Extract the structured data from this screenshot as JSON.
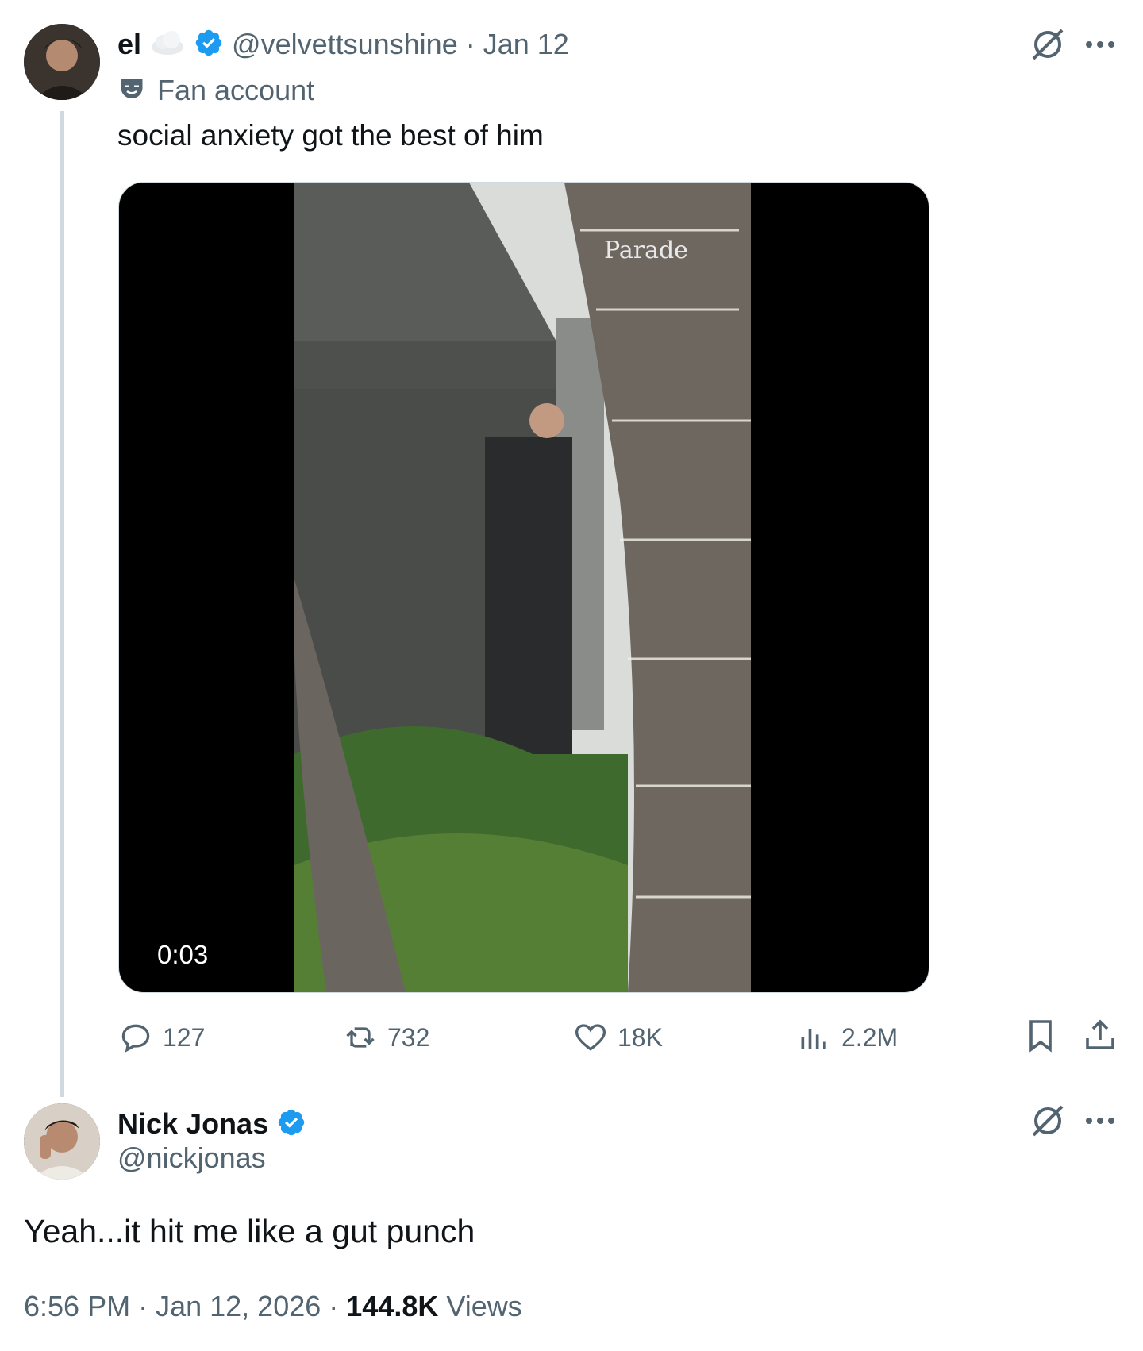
{
  "parent_tweet": {
    "display_name": "el",
    "name_emoji": "cloud",
    "handle": "@velvettsunshine",
    "separator": "·",
    "date": "Jan 12",
    "label": "Fan account",
    "label_icon": "theater-mask-icon",
    "text": "social anxiety got the best of him",
    "media": {
      "watermark": "Parade",
      "duration": "0:03"
    },
    "actions": {
      "replies": "127",
      "reposts": "732",
      "likes": "18K",
      "views": "2.2M"
    }
  },
  "reply_tweet": {
    "display_name": "Nick Jonas",
    "handle": "@nickjonas",
    "text": "Yeah...it hit me like a gut punch",
    "time": "6:56 PM",
    "separator": "·",
    "date": "Jan 12, 2026",
    "separator2": "·",
    "views_count": "144.8K",
    "views_label": "Views"
  },
  "colors": {
    "verified": "#1d9bf0",
    "text": "#0f1419",
    "muted": "#536471",
    "thread_line": "#cfd9de"
  },
  "icons": {
    "grok": "grok-icon",
    "more": "more-icon",
    "reply": "reply-icon",
    "repost": "repost-icon",
    "like": "heart-icon",
    "views": "analytics-icon",
    "bookmark": "bookmark-icon",
    "share": "share-icon",
    "verified": "verified-badge-icon"
  }
}
